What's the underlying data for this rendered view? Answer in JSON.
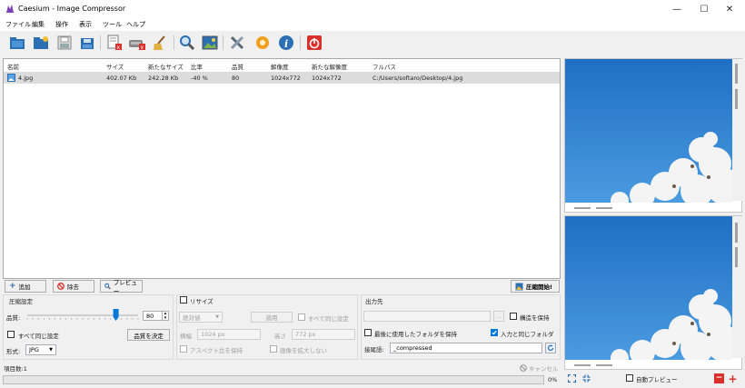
{
  "window": {
    "title": "Caesium - Image Compressor",
    "minimize": "—",
    "maximize": "☐",
    "close": "✕"
  },
  "menu": [
    "ファイル",
    "編集",
    "操作",
    "表示",
    "ツール",
    "ヘルプ"
  ],
  "toolbar": {
    "icons": [
      "open-file-icon",
      "open-folder-icon",
      "save-icon",
      "save-all-icon",
      "remove-item-icon",
      "remove-all-icon",
      "clear-list-icon",
      "search-icon",
      "preview-image-icon",
      "tools-icon",
      "settings-icon",
      "about-icon",
      "quit-icon"
    ]
  },
  "list": {
    "columns": [
      "名前",
      "サイズ",
      "新たなサイズ",
      "比率",
      "品質",
      "解像度",
      "新たな解像度",
      "フルパス"
    ],
    "rows": [
      {
        "name": "4.jpg",
        "size": "402.07 Kb",
        "new_size": "242.28 Kb",
        "ratio": "-40 %",
        "quality": "80",
        "resolution": "1024x772",
        "new_resolution": "1024x772",
        "path": "C:/Users/softaro/Desktop/4.jpg"
      }
    ]
  },
  "actions": {
    "add": "追加",
    "remove": "除去",
    "preview": "プレビュー",
    "compress": "圧縮開始!"
  },
  "compression": {
    "title": "圧縮設定",
    "quality_label": "品質:",
    "quality_value": "80",
    "quality_fraction": 0.8,
    "same_for_all": "すべて同じ設定",
    "set_quality": "品質を決定",
    "format_label": "形式:",
    "format_value": "JPG"
  },
  "resize": {
    "title": "リサイズ",
    "mode": "絶対値",
    "apply": "適用",
    "same_for_all": "すべて同じ設定",
    "width_label": "横幅",
    "width_value": "1024 px",
    "height_label": "高さ",
    "height_value": "772 px",
    "keep_aspect": "アスペクト比を保持",
    "no_enlarge": "画像を拡大しない"
  },
  "output": {
    "title": "出力先",
    "browse": "...",
    "keep_structure": "構造を保持",
    "keep_last_folder": "最後に使用したフォルダを保持",
    "same_as_input": "入力と同じフォルダ",
    "suffix_label": "接尾語:",
    "suffix_value": "_compressed"
  },
  "status": {
    "item_count": "項目数:1",
    "cancel": "キャンセル",
    "progress_text": "0%",
    "progress": 0,
    "auto_preview": "自動プレビュー"
  },
  "colors": {
    "sky": "#2b7fd1",
    "accent": "#0078d7",
    "danger": "#d9302c"
  }
}
